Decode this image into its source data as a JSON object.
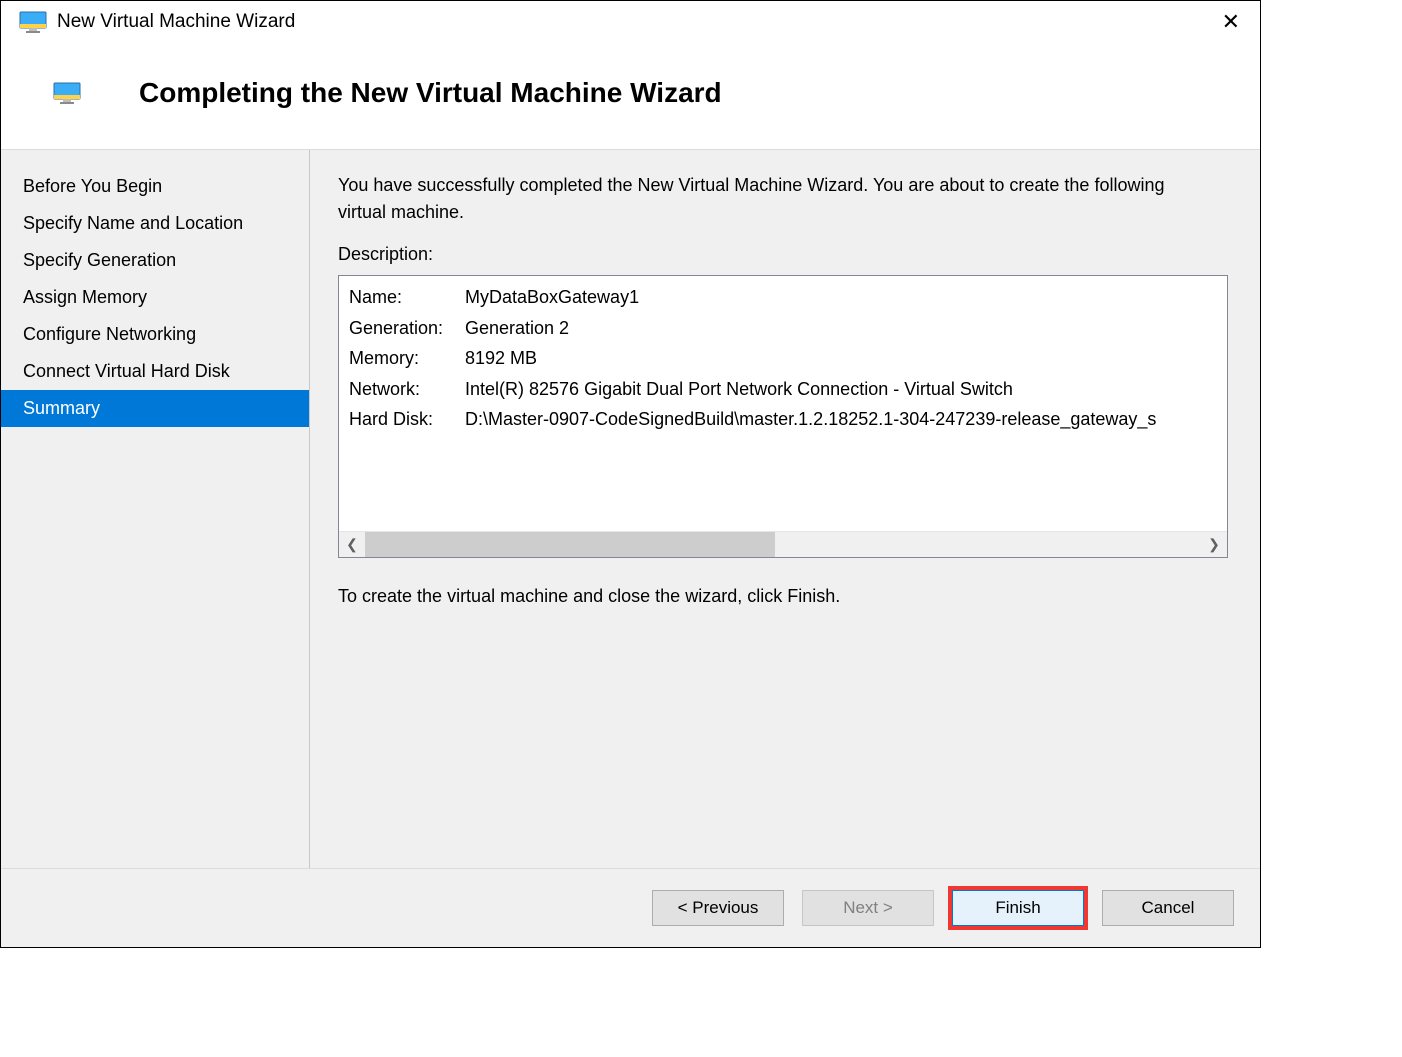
{
  "window": {
    "title": "New Virtual Machine Wizard"
  },
  "header": {
    "heading": "Completing the New Virtual Machine Wizard"
  },
  "sidebar": {
    "items": [
      {
        "label": "Before You Begin"
      },
      {
        "label": "Specify Name and Location"
      },
      {
        "label": "Specify Generation"
      },
      {
        "label": "Assign Memory"
      },
      {
        "label": "Configure Networking"
      },
      {
        "label": "Connect Virtual Hard Disk"
      },
      {
        "label": "Summary"
      }
    ]
  },
  "main": {
    "intro": "You have successfully completed the New Virtual Machine Wizard. You are about to create the following virtual machine.",
    "description_label": "Description:",
    "description": {
      "rows": [
        {
          "key": "Name:",
          "value": "MyDataBoxGateway1"
        },
        {
          "key": "Generation:",
          "value": "Generation 2"
        },
        {
          "key": "Memory:",
          "value": "8192 MB"
        },
        {
          "key": "Network:",
          "value": "Intel(R) 82576 Gigabit Dual Port Network Connection - Virtual Switch"
        },
        {
          "key": "Hard Disk:",
          "value": "D:\\Master-0907-CodeSignedBuild\\master.1.2.18252.1-304-247239-release_gateway_s"
        }
      ]
    },
    "closing": "To create the virtual machine and close the wizard, click Finish."
  },
  "footer": {
    "previous": "< Previous",
    "next": "Next >",
    "finish": "Finish",
    "cancel": "Cancel"
  },
  "scroll": {
    "left_glyph": "❮",
    "right_glyph": "❯"
  }
}
